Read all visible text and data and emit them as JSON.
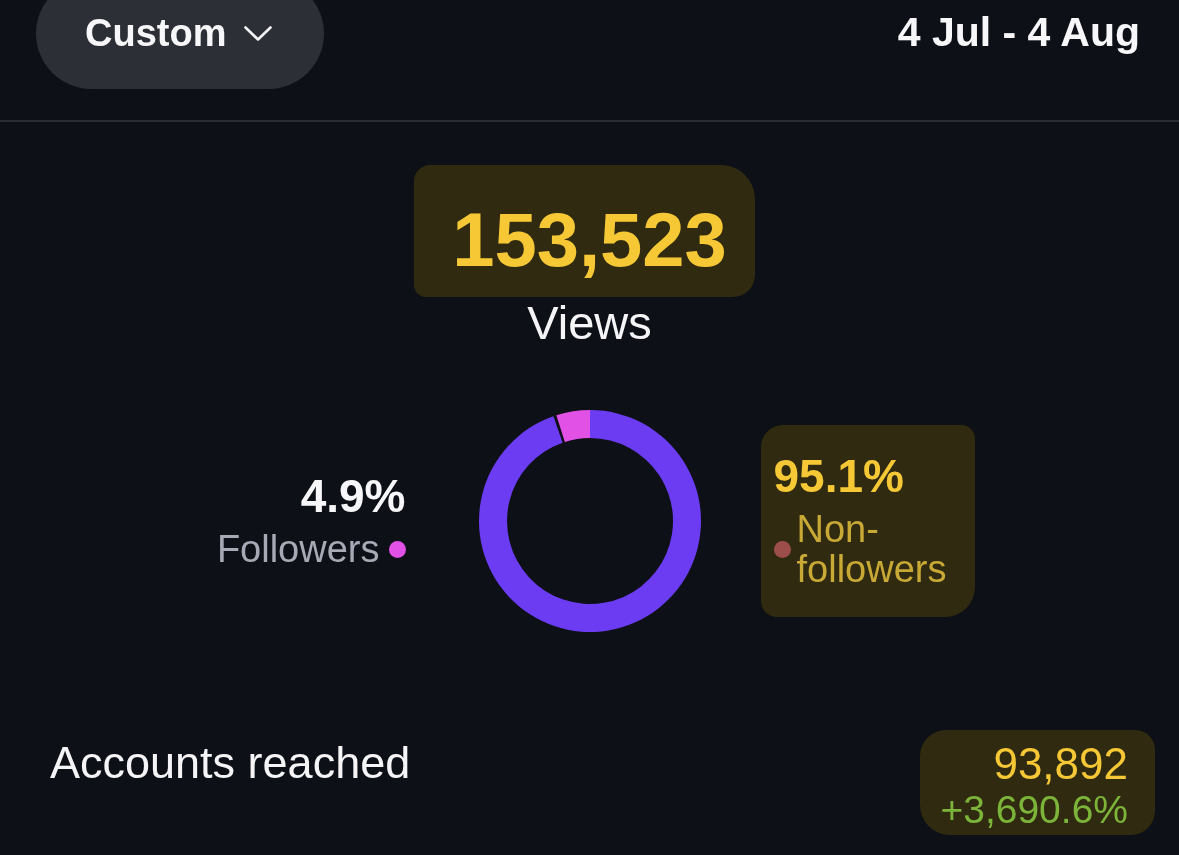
{
  "header": {
    "range_button": {
      "label": "Custom"
    },
    "date_range": "4 Jul - 4 Aug"
  },
  "views": {
    "value": "153,523",
    "label": "Views",
    "highlighted": true
  },
  "audience": {
    "chart_data": {
      "type": "donut",
      "categories": [
        "Followers",
        "Non-followers"
      ],
      "values": [
        4.9,
        95.1
      ],
      "colors": [
        "#e251e6",
        "#6b3cf1"
      ]
    },
    "legend": [
      {
        "share": "4.9%",
        "color": "#e251e6",
        "highlighted": false
      },
      {
        "share": "95.1%",
        "color": "#9e4e4a",
        "highlighted": true
      }
    ]
  },
  "accounts_reached": {
    "label": "Accounts reached",
    "value": "93,892",
    "change": "+3,690.6%",
    "highlighted": true
  }
}
